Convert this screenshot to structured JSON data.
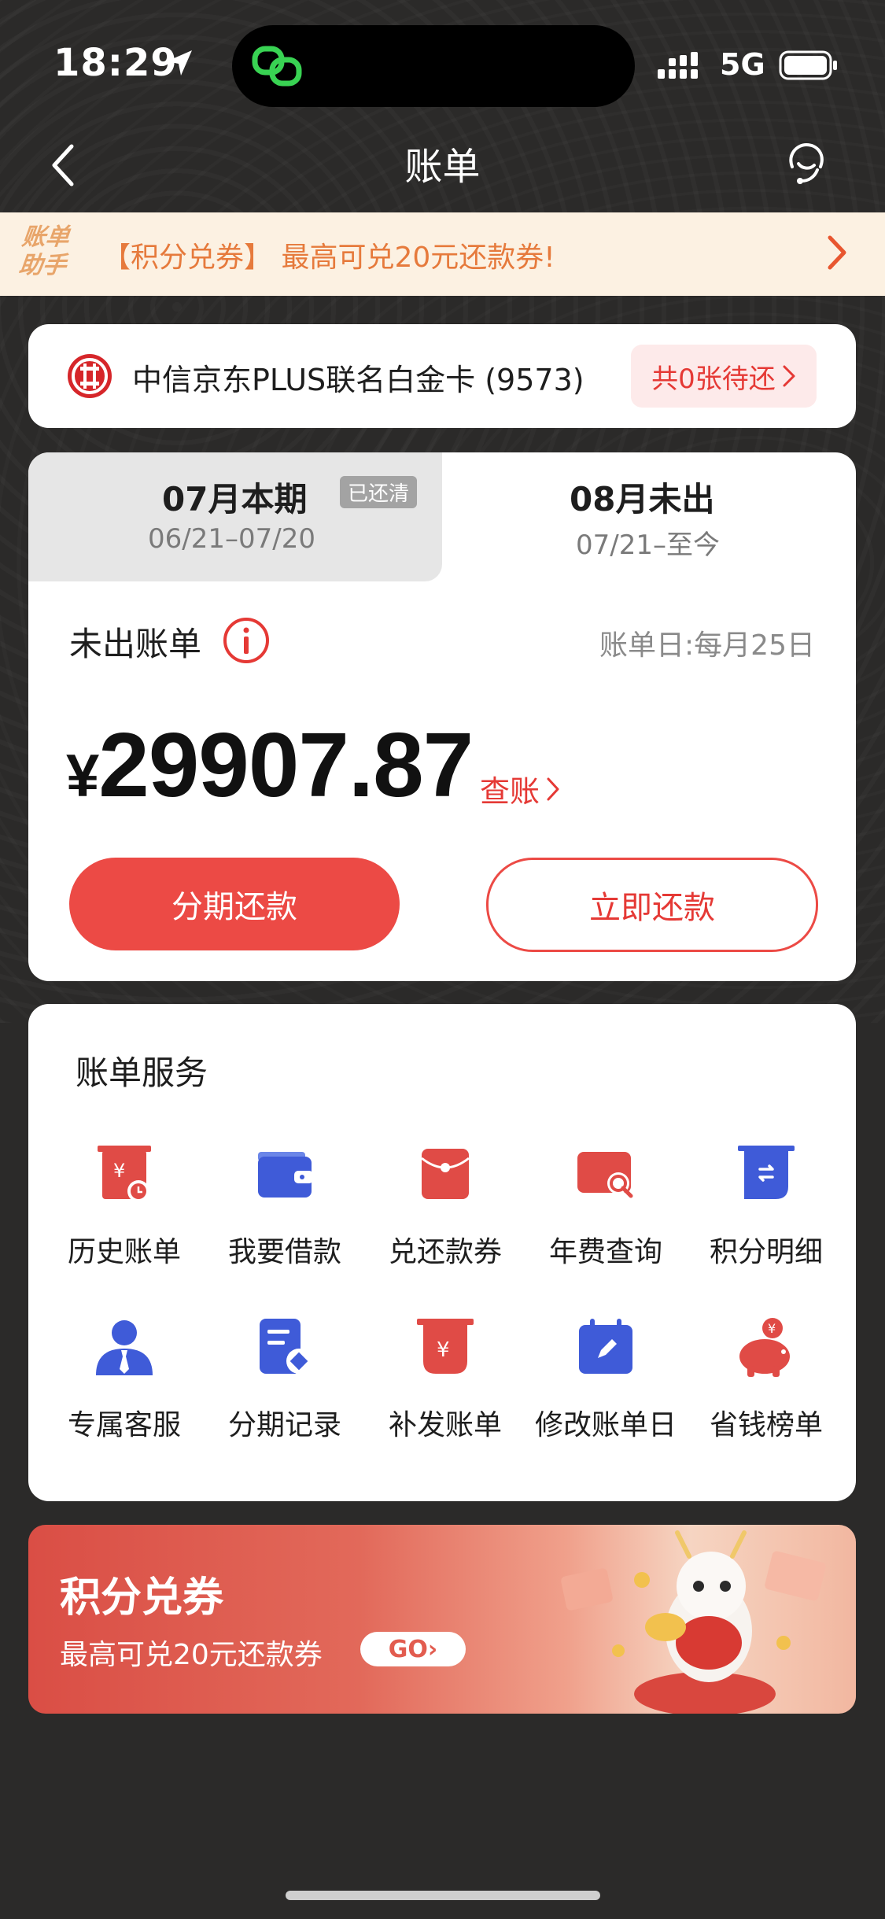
{
  "status_bar": {
    "time": "18:29",
    "network": "5G"
  },
  "nav": {
    "title": "账单"
  },
  "assistant_banner": {
    "logo_line1": "账单",
    "logo_line2": "助手",
    "text": "【积分兑券】 最高可兑20元还款券!"
  },
  "card": {
    "name": "中信京东PLUS联名白金卡 (9573)",
    "pending": "共0张待还"
  },
  "bill": {
    "current_tab": {
      "title": "07月本期",
      "period": "06/21–07/20",
      "badge": "已还清"
    },
    "next_tab": {
      "title": "08月未出",
      "period": "07/21–至今"
    },
    "section_label": "未出账单",
    "bill_day": "账单日:每月25日",
    "currency": "¥",
    "amount": "29907.87",
    "check_link": "查账",
    "installment_button": "分期还款",
    "repay_button": "立即还款"
  },
  "services": {
    "title": "账单服务",
    "items": [
      {
        "label": "历史账单",
        "icon": "history-bill-icon"
      },
      {
        "label": "我要借款",
        "icon": "wallet-icon"
      },
      {
        "label": "兑还款券",
        "icon": "red-envelope-icon"
      },
      {
        "label": "年费查询",
        "icon": "card-search-icon"
      },
      {
        "label": "积分明细",
        "icon": "points-detail-icon"
      },
      {
        "label": "专属客服",
        "icon": "customer-service-icon"
      },
      {
        "label": "分期记录",
        "icon": "installment-record-icon"
      },
      {
        "label": "补发账单",
        "icon": "reissue-bill-icon"
      },
      {
        "label": "修改账单日",
        "icon": "calendar-edit-icon"
      },
      {
        "label": "省钱榜单",
        "icon": "piggy-bank-icon"
      }
    ]
  },
  "promo": {
    "title": "积分兑券",
    "subtitle": "最高可兑20元还款券",
    "go": "GO"
  },
  "colors": {
    "accent_red": "#ec4a45",
    "icon_red": "#e04b46",
    "icon_blue": "#3f5bd8",
    "banner_bg": "#fcf1e2"
  }
}
